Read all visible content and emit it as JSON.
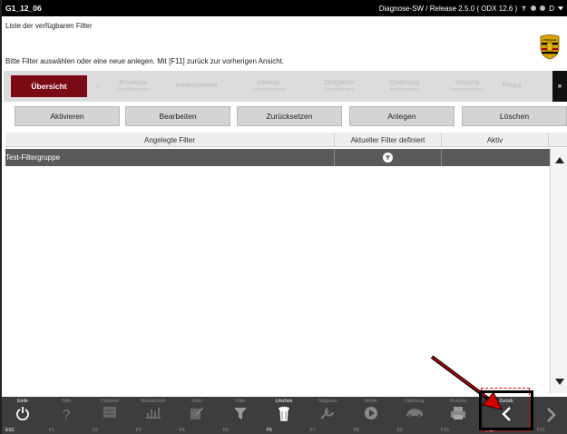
{
  "titlebar": {
    "code": "G1_12_06",
    "info": "Diagnose-SW / Release  2.5.0 ( ODX  12.6 )",
    "trail_letter": "D"
  },
  "info": {
    "line1": "Liste der verfügbaren Filter",
    "line2": "Bitte Filter auswählen oder eine neue anlegen. Mit [F11] zurück zur vorherigen Ansicht."
  },
  "tabs": [
    {
      "label": "Übersicht",
      "sub": ""
    },
    {
      "label": "»",
      "sub": ""
    },
    {
      "label": "Erweiterte",
      "sub": "Identifikationen"
    },
    {
      "label": "Fehlerspeicher",
      "sub": ""
    },
    {
      "label": "Istwerte",
      "sub": "Schaltzustände"
    },
    {
      "label": "Stellglieder",
      "sub": "Einstellungen"
    },
    {
      "label": "Codierung",
      "sub": "Anpassungen"
    },
    {
      "label": "Wartung",
      "sub": "Instandsetzung"
    },
    {
      "label": "Progra",
      "sub": ""
    },
    {
      "label": "»",
      "sub": ""
    }
  ],
  "actions": {
    "activate": "Aktivieren",
    "edit": "Bearbeiten",
    "reset": "Zurücksetzen",
    "create": "Anlegen",
    "delete": "Löschen"
  },
  "table": {
    "columns": [
      "Angelegte Filter",
      "Aktueller Filter definiert",
      "Aktiv"
    ],
    "rows": [
      {
        "name": "Test-Filtergruppe",
        "defined_icon": "filter-icon",
        "active": ""
      }
    ]
  },
  "toolbar": [
    {
      "label": "Ende",
      "key": "ESC",
      "icon": "power-icon",
      "enabled": true
    },
    {
      "label": "Hilfe",
      "key": "F1",
      "icon": "help-icon",
      "enabled": false
    },
    {
      "label": "Protokoll",
      "key": "F2",
      "icon": "log-icon",
      "enabled": false
    },
    {
      "label": "Messtechnik",
      "key": "F3",
      "icon": "chart-icon",
      "enabled": false
    },
    {
      "label": "Notiz",
      "key": "F4",
      "icon": "note-icon",
      "enabled": false
    },
    {
      "label": "Filter",
      "key": "F5",
      "icon": "filter-icon",
      "enabled": false
    },
    {
      "label": "Löschen",
      "key": "F6",
      "icon": "trash-icon",
      "enabled": true
    },
    {
      "label": "Diagnose",
      "key": "F7",
      "icon": "tool-icon",
      "enabled": false
    },
    {
      "label": "Weiter",
      "key": "F8",
      "icon": "play-icon",
      "enabled": false
    },
    {
      "label": "Fahrzeug",
      "key": "F9",
      "icon": "car-icon",
      "enabled": false
    },
    {
      "label": "Drucken",
      "key": "F10",
      "icon": "print-icon",
      "enabled": false
    },
    {
      "label": "Zurück",
      "key": "F11",
      "icon": "chevron-left-icon",
      "enabled": true
    },
    {
      "label": "",
      "key": "F12",
      "icon": "chevron-right-icon",
      "enabled": false
    }
  ],
  "colors": {
    "titlebar": "#000000",
    "active_tab": "#7a0a14",
    "selected_row": "#5a5a5a",
    "toolbar": "#3d3d3d",
    "annotation_arrow": "#d00000"
  }
}
